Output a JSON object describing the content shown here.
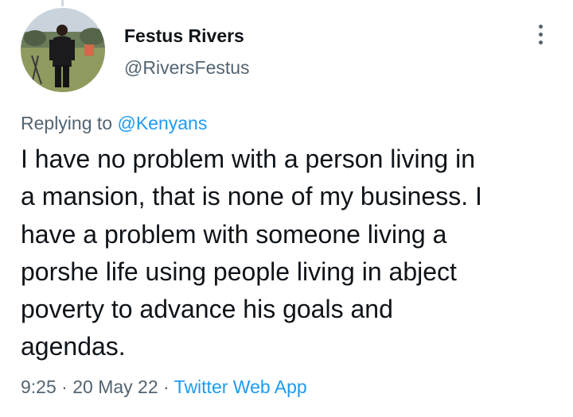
{
  "tweet": {
    "author": {
      "display_name": "Festus Rivers",
      "handle": "@RiversFestus"
    },
    "replying_label": "Replying to",
    "reply_to_mention": "@Kenyans",
    "text_lines": [
      "I have no problem with a person living in",
      "a mansion, that is none of my business. I",
      "have a problem with someone living a",
      "porshe life using people living in abject",
      "poverty to advance his goals and",
      "agendas."
    ],
    "time": "9:25",
    "date": "20 May 22",
    "separator": "·",
    "source": "Twitter Web App"
  },
  "colors": {
    "text": "#0f1419",
    "secondary": "#536471",
    "accent": "#1d9bf0"
  },
  "icons": {
    "more": "more-vertical-icon"
  }
}
